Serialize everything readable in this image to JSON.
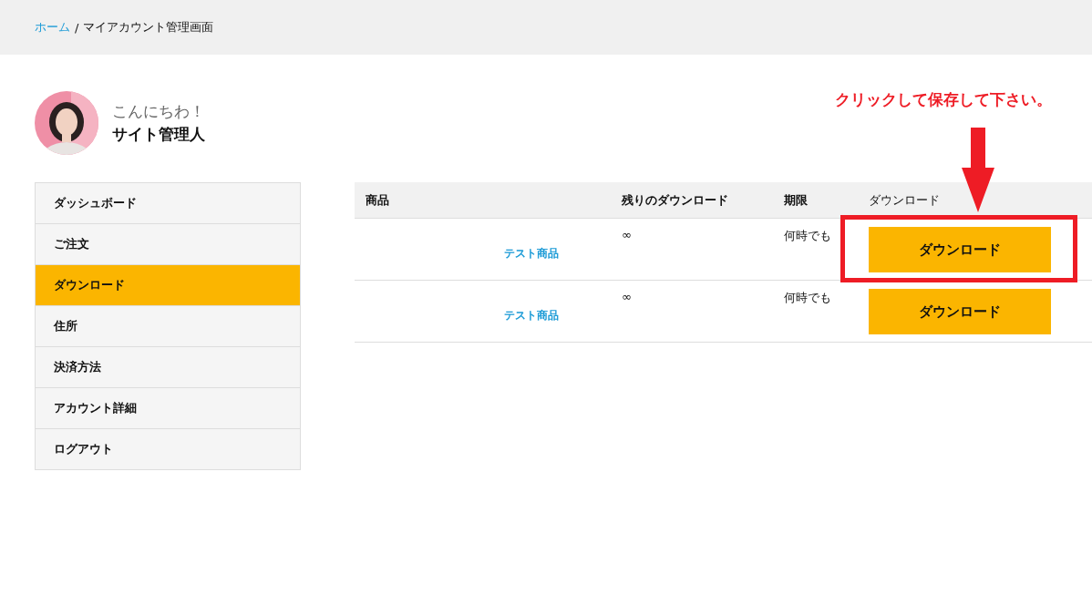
{
  "breadcrumb": {
    "home": "ホーム",
    "separator": "/",
    "current": "マイアカウント管理画面"
  },
  "user": {
    "greeting": "こんにちわ！",
    "name": "サイト管理人"
  },
  "sidebar": {
    "items": [
      {
        "label": "ダッシュボード",
        "selected": false
      },
      {
        "label": "ご注文",
        "selected": false
      },
      {
        "label": "ダウンロード",
        "selected": true
      },
      {
        "label": "住所",
        "selected": false
      },
      {
        "label": "決済方法",
        "selected": false
      },
      {
        "label": "アカウント詳細",
        "selected": false
      },
      {
        "label": "ログアウト",
        "selected": false
      }
    ]
  },
  "annotation": {
    "text": "クリックして保存して下さい。"
  },
  "table": {
    "columns": [
      "商品",
      "残りのダウンロード",
      "期限",
      "ダウンロード"
    ],
    "rows": [
      {
        "product": "テスト商品",
        "remaining": "∞",
        "expires": "何時でも",
        "button": "ダウンロード",
        "highlighted": true
      },
      {
        "product": "テスト商品",
        "remaining": "∞",
        "expires": "何時でも",
        "button": "ダウンロード",
        "highlighted": false
      }
    ]
  }
}
